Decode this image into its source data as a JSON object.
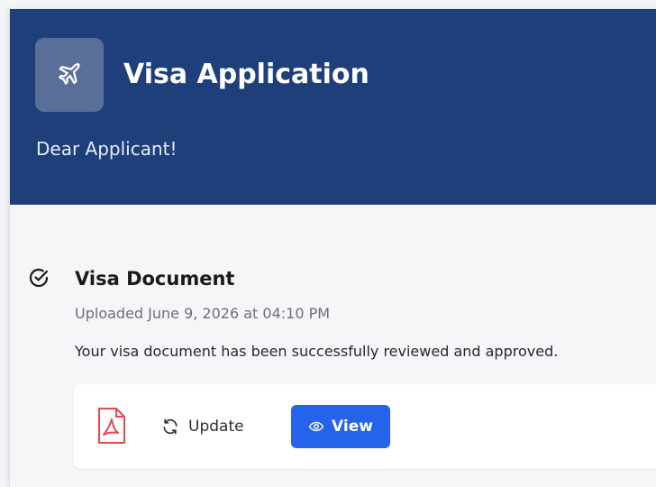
{
  "header": {
    "title": "Visa Application",
    "greeting": "Dear Applicant!",
    "icon": "airplane-icon",
    "background_color": "#1f3f7a"
  },
  "document": {
    "status_icon": "check-circle-icon",
    "title": "Visa Document",
    "uploaded": "Uploaded June 9, 2026 at 04:10 PM",
    "description": "Your visa document has been successfully reviewed and approved.",
    "file_icon": "pdf-file-icon"
  },
  "actions": {
    "update_label": "Update",
    "update_icon": "refresh-icon",
    "view_label": "View",
    "view_icon": "eye-icon",
    "view_color": "#2563eb",
    "pdf_color": "#e5484d"
  }
}
